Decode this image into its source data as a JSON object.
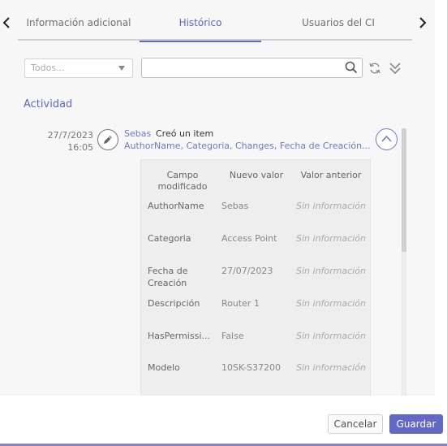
{
  "tabs": [
    {
      "label": "Información adicional"
    },
    {
      "label": "Histórico"
    },
    {
      "label": "Usuarios del CI"
    }
  ],
  "filters": {
    "select_placeholder": "Todos...",
    "search_value": ""
  },
  "section_title": "Actividad",
  "activity": {
    "date": "27/7/2023",
    "time": "16:05",
    "user": "Sebas",
    "action": "Creó un item",
    "summary": "AuthorName, Categoria, Changes, Fecha de Creación..."
  },
  "changes_table": {
    "headers": [
      "Campo modificado",
      "Nuevo valor",
      "Valor anterior"
    ],
    "rows": [
      {
        "field": "AuthorName",
        "new": "Sebas",
        "old": "Sin información"
      },
      {
        "field": "Categoria",
        "new": "Access Point",
        "old": "Sin información"
      },
      {
        "field": "Fecha de Creación",
        "new": "27/07/2023",
        "old": "Sin información"
      },
      {
        "field": "Descripción",
        "new": "Router 1",
        "old": "Sin información"
      },
      {
        "field": "HasPermissi...",
        "new": "False",
        "old": "Sin información"
      },
      {
        "field": "Modelo",
        "new": "10SK-S37200",
        "old": "Sin información"
      }
    ]
  },
  "footer": {
    "cancel_label": "Cancelar",
    "save_label": "Guardar"
  },
  "colors": {
    "accent": "#5a6bc4",
    "save_button": "#6468c4",
    "footer_line": "#8a82c4"
  },
  "icons": [
    "chevron-left-icon",
    "chevron-right-icon",
    "search-icon",
    "refresh-icon",
    "double-chevron-down-icon",
    "pencil-icon",
    "chevron-up-icon"
  ]
}
